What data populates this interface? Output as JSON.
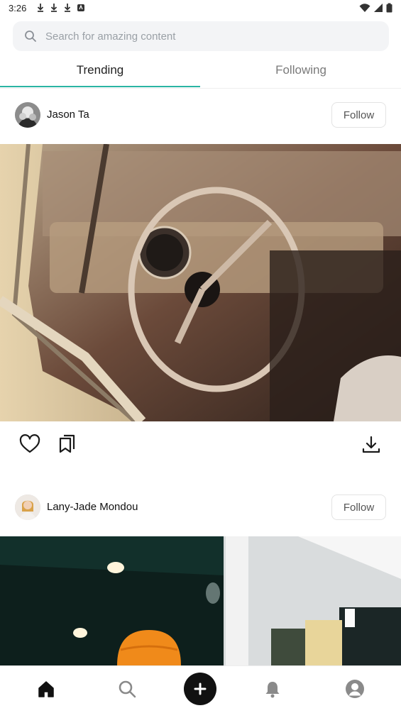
{
  "status_bar": {
    "time": "3:26",
    "left_icons": [
      "download-icon",
      "download-icon",
      "download-icon",
      "app-notification-icon"
    ],
    "right_icons": [
      "wifi-icon",
      "signal-icon",
      "battery-icon"
    ]
  },
  "search": {
    "placeholder": "Search for amazing content"
  },
  "tabs": [
    {
      "label": "Trending",
      "active": true
    },
    {
      "label": "Following",
      "active": false
    }
  ],
  "accent_color": "#2bb5a3",
  "posts": [
    {
      "author": "Jason Ta",
      "follow_label": "Follow",
      "image_subject": "vintage-car-interior-photo",
      "actions": [
        "heart-icon",
        "bookmark-icon",
        "download-icon"
      ]
    },
    {
      "author": "Lany-Jade Mondou",
      "follow_label": "Follow",
      "image_subject": "person-orange-beanie-photo"
    }
  ],
  "bottom_nav": {
    "items": [
      "home-icon",
      "search-icon",
      "create-button",
      "bell-icon",
      "profile-icon"
    ]
  }
}
